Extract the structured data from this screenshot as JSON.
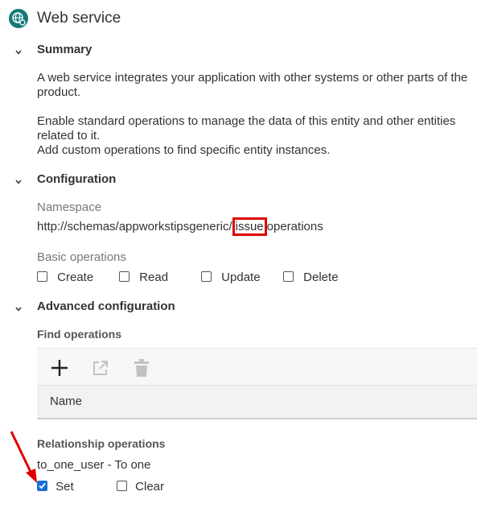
{
  "header": {
    "title": "Web service",
    "icon": "globe-gear-icon"
  },
  "summary": {
    "heading": "Summary",
    "para1_line1": "A web service integrates your application with other systems or other parts of the",
    "para1_line2": "product.",
    "para2_line1": "Enable standard operations to manage the data of this entity and other entities",
    "para2_line2": "related to it.",
    "para3": "Add custom operations to find specific entity instances."
  },
  "configuration": {
    "heading": "Configuration",
    "namespace_label": "Namespace",
    "namespace_prefix": "http://schemas/appworkstipsgeneric/",
    "namespace_highlight": "issue",
    "namespace_suffix": "operations",
    "basic_ops_label": "Basic operations",
    "basic_ops": [
      "Create",
      "Read",
      "Update",
      "Delete"
    ]
  },
  "advanced": {
    "heading": "Advanced configuration",
    "find_ops_label": "Find operations",
    "toolbar_icons": [
      "add-icon",
      "open-external-icon",
      "delete-icon"
    ],
    "table_column": "Name",
    "relationship_label": "Relationship operations",
    "relationship_name": "to_one_user - To one",
    "relationship_ops": [
      {
        "label": "Set",
        "checked": true
      },
      {
        "label": "Clear",
        "checked": false
      }
    ]
  },
  "colors": {
    "brand": "#127a78",
    "highlight_box": "#e00000",
    "arrow": "#e00000",
    "checkbox_checked": "#1a6fd6"
  }
}
